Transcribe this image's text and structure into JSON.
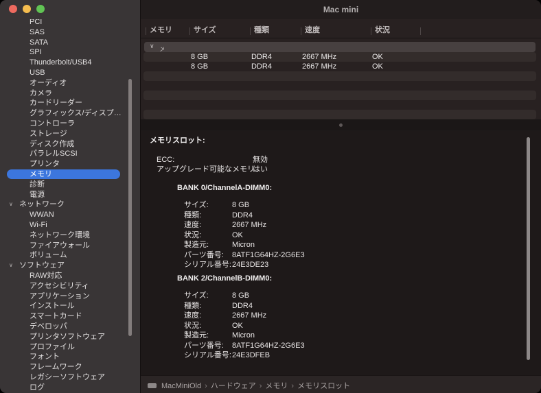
{
  "window": {
    "title": "Mac mini"
  },
  "sidebar": {
    "items": [
      {
        "label": "PCI",
        "type": "child"
      },
      {
        "label": "SAS",
        "type": "child"
      },
      {
        "label": "SATA",
        "type": "child"
      },
      {
        "label": "SPI",
        "type": "child"
      },
      {
        "label": "Thunderbolt/USB4",
        "type": "child"
      },
      {
        "label": "USB",
        "type": "child"
      },
      {
        "label": "オーディオ",
        "type": "child"
      },
      {
        "label": "カメラ",
        "type": "child"
      },
      {
        "label": "カードリーダー",
        "type": "child"
      },
      {
        "label": "グラフィックス/ディスプ…",
        "type": "child"
      },
      {
        "label": "コントローラ",
        "type": "child"
      },
      {
        "label": "ストレージ",
        "type": "child"
      },
      {
        "label": "ディスク作成",
        "type": "child"
      },
      {
        "label": "パラレルSCSI",
        "type": "child"
      },
      {
        "label": "プリンタ",
        "type": "child"
      },
      {
        "label": "メモリ",
        "type": "child",
        "selected": true
      },
      {
        "label": "診断",
        "type": "child"
      },
      {
        "label": "電源",
        "type": "child"
      },
      {
        "label": "ネットワーク",
        "type": "group"
      },
      {
        "label": "WWAN",
        "type": "child"
      },
      {
        "label": "Wi-Fi",
        "type": "child"
      },
      {
        "label": "ネットワーク環境",
        "type": "child"
      },
      {
        "label": "ファイアウォール",
        "type": "child"
      },
      {
        "label": "ボリューム",
        "type": "child"
      },
      {
        "label": "ソフトウェア",
        "type": "group"
      },
      {
        "label": "RAW対応",
        "type": "child"
      },
      {
        "label": "アクセシビリティ",
        "type": "child"
      },
      {
        "label": "アプリケーション",
        "type": "child"
      },
      {
        "label": "インストール",
        "type": "child"
      },
      {
        "label": "スマートカード",
        "type": "child"
      },
      {
        "label": "デベロッパ",
        "type": "child"
      },
      {
        "label": "プリンタソフトウェア",
        "type": "child"
      },
      {
        "label": "プロファイル",
        "type": "child"
      },
      {
        "label": "フォント",
        "type": "child"
      },
      {
        "label": "フレームワーク",
        "type": "child"
      },
      {
        "label": "レガシーソフトウェア",
        "type": "child"
      },
      {
        "label": "ログ",
        "type": "child"
      }
    ],
    "chevron": "∨"
  },
  "table": {
    "columns": [
      "メモリ",
      "サイズ",
      "種類",
      "速度",
      "状況"
    ],
    "group_row_label": "メモリスロット",
    "rows": [
      {
        "size": "8 GB",
        "type": "DDR4",
        "speed": "2667 MHz",
        "status": "OK"
      },
      {
        "size": "8 GB",
        "type": "DDR4",
        "speed": "2667 MHz",
        "status": "OK"
      }
    ],
    "empty_row_count": 5
  },
  "detail": {
    "title": "メモリスロット:",
    "summary": [
      {
        "label": "ECC:",
        "value": "無効"
      },
      {
        "label": "アップグレード可能なメモリ:",
        "value": "はい"
      }
    ],
    "banks": [
      {
        "title": "BANK 0/ChannelA-DIMM0:",
        "rows": [
          {
            "label": "サイズ:",
            "value": "8 GB"
          },
          {
            "label": "種類:",
            "value": "DDR4"
          },
          {
            "label": "速度:",
            "value": "2667 MHz"
          },
          {
            "label": "状況:",
            "value": "OK"
          },
          {
            "label": "製造元:",
            "value": "Micron"
          },
          {
            "label": "パーツ番号:",
            "value": "8ATF1G64HZ-2G6E3"
          },
          {
            "label": "シリアル番号:",
            "value": "24E3DE23"
          }
        ]
      },
      {
        "title": "BANK 2/ChannelB-DIMM0:",
        "rows": [
          {
            "label": "サイズ:",
            "value": "8 GB"
          },
          {
            "label": "種類:",
            "value": "DDR4"
          },
          {
            "label": "速度:",
            "value": "2667 MHz"
          },
          {
            "label": "状況:",
            "value": "OK"
          },
          {
            "label": "製造元:",
            "value": "Micron"
          },
          {
            "label": "パーツ番号:",
            "value": "8ATF1G64HZ-2G6E3"
          },
          {
            "label": "シリアル番号:",
            "value": "24E3DFEB"
          }
        ]
      }
    ]
  },
  "statusbar": {
    "crumbs": [
      "MacMiniOld",
      "ハードウェア",
      "メモリ",
      "メモリスロット"
    ],
    "separator": "›"
  },
  "colors": {
    "accent_blue": "#3c76dd",
    "sidebar_bg": "#393536",
    "pane_bg": "#282121",
    "detail_bg": "#1e1919",
    "titlebar_bg": "#221d1d",
    "traffic_red": "#ee6a5f",
    "traffic_yellow": "#f5bd4f",
    "traffic_green": "#61c454"
  }
}
